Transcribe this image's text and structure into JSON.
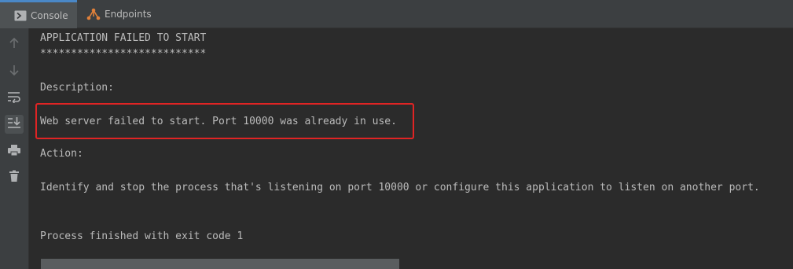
{
  "tabs": [
    {
      "label": "Console",
      "icon": "console-icon"
    },
    {
      "label": "Endpoints",
      "icon": "endpoints-icon"
    }
  ],
  "toolbar": {
    "buttons": [
      {
        "icon": "arrow-up-icon"
      },
      {
        "icon": "arrow-down-icon"
      },
      {
        "icon": "soft-wrap-icon"
      },
      {
        "icon": "scroll-to-end-icon",
        "active": true
      },
      {
        "icon": "print-icon"
      },
      {
        "icon": "trash-icon"
      }
    ]
  },
  "console": {
    "header": "APPLICATION FAILED TO START",
    "separator": "***************************",
    "description_label": "Description:",
    "error_message": "Web server failed to start. Port 10000 was already in use.",
    "action_label": "Action:",
    "action_text": "Identify and stop the process that's listening on port 10000 or configure this application to listen on another port.",
    "exit_message": "Process finished with exit code 1"
  },
  "colors": {
    "background": "#2b2b2b",
    "panel": "#3c3f41",
    "text": "#bbbbbb",
    "highlight_border": "#e02424",
    "active_tab_accent": "#4a88c7"
  }
}
